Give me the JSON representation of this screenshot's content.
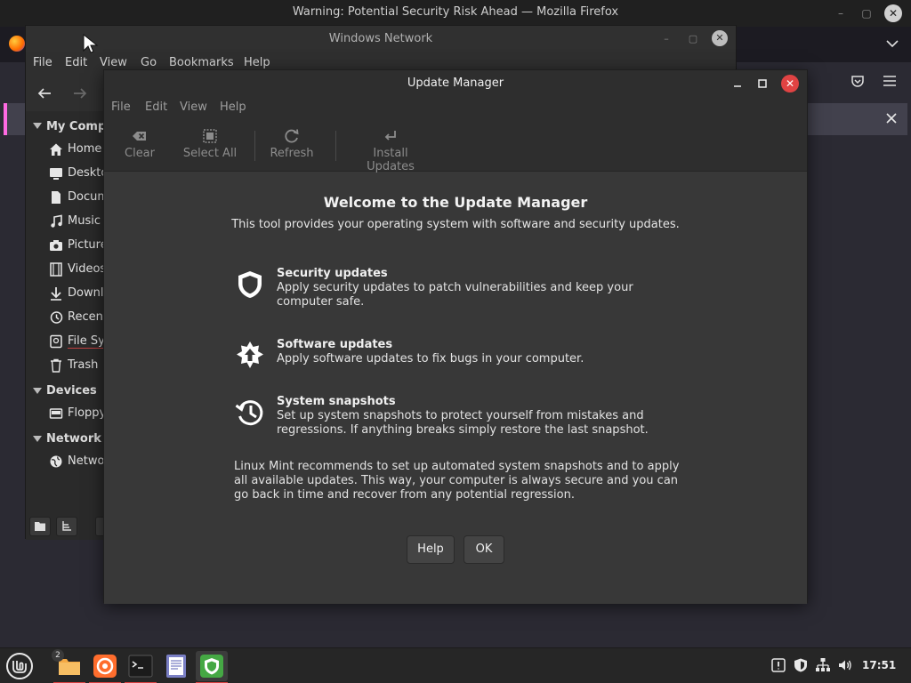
{
  "firefox": {
    "title": "Warning: Potential Security Risk Ahead — Mozilla Firefox",
    "minimize": "–",
    "maximize": "▢",
    "close": "✕"
  },
  "nemo": {
    "title": "Windows Network",
    "menu": [
      "File",
      "Edit",
      "View",
      "Go",
      "Bookmarks",
      "Help"
    ],
    "sidebar": {
      "sections": {
        "my_computer": "My Computer",
        "devices": "Devices",
        "network": "Network"
      },
      "items": [
        {
          "label": "Home",
          "icon": "home-icon"
        },
        {
          "label": "Desktop",
          "icon": "desktop-icon"
        },
        {
          "label": "Documents",
          "icon": "document-icon"
        },
        {
          "label": "Music",
          "icon": "music-icon"
        },
        {
          "label": "Pictures",
          "icon": "camera-icon"
        },
        {
          "label": "Videos",
          "icon": "film-icon"
        },
        {
          "label": "Downloads",
          "icon": "download-icon"
        },
        {
          "label": "Recent",
          "icon": "recent-icon"
        },
        {
          "label": "File System",
          "icon": "drive-icon"
        },
        {
          "label": "Trash",
          "icon": "trash-icon"
        }
      ],
      "devices": [
        {
          "label": "Floppy",
          "icon": "floppy-icon"
        }
      ],
      "network": [
        {
          "label": "Network",
          "icon": "globe-icon"
        }
      ]
    }
  },
  "update_manager": {
    "title": "Update Manager",
    "menu": [
      "File",
      "Edit",
      "View",
      "Help"
    ],
    "toolbar": {
      "clear": "Clear",
      "select_all": "Select All",
      "refresh": "Refresh",
      "install_updates": "Install Updates"
    },
    "welcome": {
      "title": "Welcome to the Update Manager",
      "subtitle": "This tool provides your operating system with software and security updates."
    },
    "features": [
      {
        "title": "Security updates",
        "description": "Apply security updates to patch vulnerabilities and keep your computer safe.",
        "icon": "shield-icon"
      },
      {
        "title": "Software updates",
        "description": "Apply software updates to fix bugs in your computer.",
        "icon": "software-update-icon"
      },
      {
        "title": "System snapshots",
        "description": "Set up system snapshots to protect yourself from mistakes and regressions. If anything breaks simply restore the last snapshot.",
        "icon": "history-icon"
      }
    ],
    "recommendation": "Linux Mint recommends to set up automated system snapshots and to apply all available updates. This way, your computer is always secure and you can go back in time and recover from any potential regression.",
    "buttons": {
      "help": "Help",
      "ok": "OK"
    }
  },
  "taskbar": {
    "files_badge": "2",
    "clock": "17:51"
  }
}
